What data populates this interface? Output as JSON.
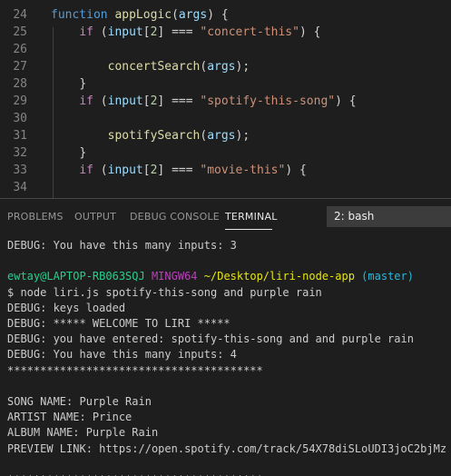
{
  "editor": {
    "lines": [
      {
        "num": "24",
        "indent": "",
        "parts": [
          [
            "kw-decl",
            "function"
          ],
          [
            "plain",
            " "
          ],
          [
            "fn",
            "appLogic"
          ],
          [
            "plain",
            "("
          ],
          [
            "var",
            "args"
          ],
          [
            "plain",
            ") {"
          ]
        ]
      },
      {
        "num": "25",
        "indent": "    ",
        "parts": [
          [
            "kw-ctrl",
            "if"
          ],
          [
            "plain",
            " ("
          ],
          [
            "var",
            "input"
          ],
          [
            "plain",
            "["
          ],
          [
            "num",
            "2"
          ],
          [
            "plain",
            "] === "
          ],
          [
            "str",
            "\"concert-this\""
          ],
          [
            "plain",
            ") {"
          ]
        ]
      },
      {
        "num": "26",
        "indent": "",
        "parts": []
      },
      {
        "num": "27",
        "indent": "        ",
        "parts": [
          [
            "fn",
            "concertSearch"
          ],
          [
            "plain",
            "("
          ],
          [
            "var",
            "args"
          ],
          [
            "plain",
            ");"
          ]
        ]
      },
      {
        "num": "28",
        "indent": "    ",
        "parts": [
          [
            "plain",
            "}"
          ]
        ]
      },
      {
        "num": "29",
        "indent": "    ",
        "parts": [
          [
            "kw-ctrl",
            "if"
          ],
          [
            "plain",
            " ("
          ],
          [
            "var",
            "input"
          ],
          [
            "plain",
            "["
          ],
          [
            "num",
            "2"
          ],
          [
            "plain",
            "] === "
          ],
          [
            "str",
            "\"spotify-this-song\""
          ],
          [
            "plain",
            ") {"
          ]
        ]
      },
      {
        "num": "30",
        "indent": "",
        "parts": []
      },
      {
        "num": "31",
        "indent": "        ",
        "parts": [
          [
            "fn",
            "spotifySearch"
          ],
          [
            "plain",
            "("
          ],
          [
            "var",
            "args"
          ],
          [
            "plain",
            ");"
          ]
        ]
      },
      {
        "num": "32",
        "indent": "    ",
        "parts": [
          [
            "plain",
            "}"
          ]
        ]
      },
      {
        "num": "33",
        "indent": "    ",
        "parts": [
          [
            "kw-ctrl",
            "if"
          ],
          [
            "plain",
            " ("
          ],
          [
            "var",
            "input"
          ],
          [
            "plain",
            "["
          ],
          [
            "num",
            "2"
          ],
          [
            "plain",
            "] === "
          ],
          [
            "str",
            "\"movie-this\""
          ],
          [
            "plain",
            ") {"
          ]
        ]
      },
      {
        "num": "34",
        "indent": "",
        "parts": []
      }
    ]
  },
  "panel": {
    "tabs": [
      "PROBLEMS",
      "OUTPUT",
      "DEBUG CONSOLE",
      "TERMINAL"
    ],
    "active_tab": "TERMINAL",
    "terminal_select": "2: bash"
  },
  "terminal": {
    "lines": [
      {
        "text": "DEBUG: You have this many inputs: 3"
      },
      {
        "text": ""
      },
      {
        "prompt": true,
        "user": "ewtay@LAPTOP-RB063SQJ",
        "shell": "MINGW64",
        "path": "~/Desktop/liri-node-app",
        "branch": "(master)"
      },
      {
        "text": "$ node liri.js spotify-this-song and purple rain"
      },
      {
        "text": "DEBUG: keys loaded"
      },
      {
        "text": "DEBUG: ***** WELCOME TO LIRI *****"
      },
      {
        "text": "DEBUG: you have entered: spotify-this-song and and purple rain"
      },
      {
        "text": "DEBUG: You have this many inputs: 4"
      },
      {
        "text": "***************************************"
      },
      {
        "text": ""
      },
      {
        "text": "SONG NAME: Purple Rain"
      },
      {
        "text": "ARTIST NAME: Prince"
      },
      {
        "text": "ALBUM NAME: Purple Rain"
      },
      {
        "text": "PREVIEW LINK: https://open.spotify.com/track/54X78diSLoUDI3joC2bjMz"
      },
      {
        "text": ""
      },
      {
        "text": "***************************************"
      }
    ]
  }
}
